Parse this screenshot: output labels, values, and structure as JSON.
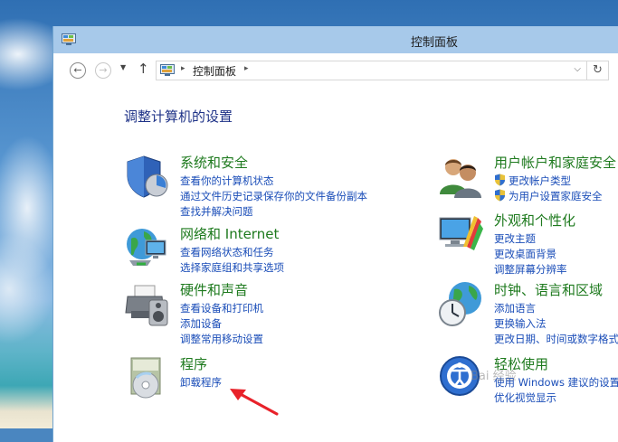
{
  "window": {
    "title": "控制面板"
  },
  "address": {
    "crumb": "控制面板",
    "sep": "▸",
    "dropdown": "⌵",
    "refresh": "↻"
  },
  "nav": {
    "back": "←",
    "forward": "→",
    "recent": "▼",
    "up": "↑"
  },
  "page": {
    "heading": "调整计算机的设置"
  },
  "categories": [
    {
      "title": "系统和安全",
      "icon": "system-security-icon",
      "links": [
        "查看你的计算机状态",
        "通过文件历史记录保存你的文件备份副本",
        "查找并解决问题"
      ]
    },
    {
      "title": "网络和 Internet",
      "icon": "network-globe-icon",
      "links": [
        "查看网络状态和任务",
        "选择家庭组和共享选项"
      ]
    },
    {
      "title": "硬件和声音",
      "icon": "printer-speaker-icon",
      "links": [
        "查看设备和打印机",
        "添加设备",
        "调整常用移动设置"
      ]
    },
    {
      "title": "程序",
      "icon": "programs-disc-icon",
      "links": [
        "卸载程序"
      ]
    },
    {
      "title": "用户帐户和家庭安全",
      "icon": "users-icon",
      "links": [
        "更改帐户类型",
        "为用户设置家庭安全"
      ]
    },
    {
      "title": "外观和个性化",
      "icon": "appearance-monitor-icon",
      "links": [
        "更改主题",
        "更改桌面背景",
        "调整屏幕分辨率"
      ]
    },
    {
      "title": "时钟、语言和区域",
      "icon": "clock-globe-icon",
      "links": [
        "添加语言",
        "更换输入法",
        "更改日期、时间或数字格式"
      ]
    },
    {
      "title": "轻松使用",
      "icon": "ease-of-access-icon",
      "links": [
        "使用 Windows 建议的设置",
        "优化视觉显示"
      ]
    }
  ],
  "overlay": {
    "watermark": "Bai 经验",
    "arrow_color": "#e8222a"
  }
}
